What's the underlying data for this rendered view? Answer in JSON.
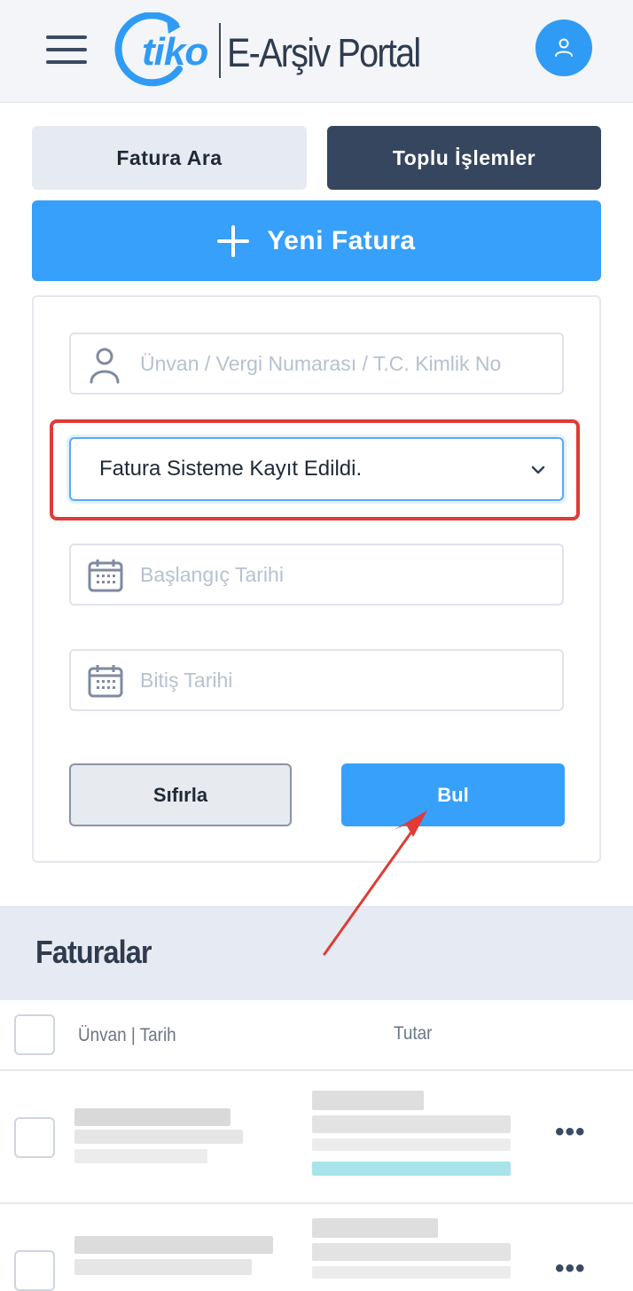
{
  "header": {
    "brand": "tiko",
    "product": "E-Arşiv Portal",
    "menu_icon": "hamburger-menu-icon",
    "profile_icon": "user-icon",
    "brand_color": "#2f9bf5"
  },
  "tabs": [
    {
      "label": "Fatura Ara",
      "active": true
    },
    {
      "label": "Toplu İşlemler",
      "active": false
    }
  ],
  "new_invoice": {
    "icon": "plus-icon",
    "label": "Yeni Fatura"
  },
  "filters": {
    "search": {
      "icon": "person-icon",
      "placeholder": "Ünvan / Vergi Numarası / T.C. Kimlik No",
      "value": ""
    },
    "status": {
      "selected": "Fatura Sisteme Kayıt Edildi.",
      "icon": "chevron-down-icon"
    },
    "start_date": {
      "icon": "calendar-icon",
      "placeholder": "Başlangıç Tarihi",
      "value": ""
    },
    "end_date": {
      "icon": "calendar-icon",
      "placeholder": "Bitiş Tarihi",
      "value": ""
    },
    "reset_label": "Sıfırla",
    "find_label": "Bul"
  },
  "invoices": {
    "title": "Faturalar",
    "columns": [
      "Ünvan | Tarih",
      "Tutar"
    ],
    "rows_visible": 2,
    "row_action_icon": "more-dots-icon"
  },
  "annotations": {
    "highlight_color": "#e03b36",
    "arrow_color": "#e03b36"
  }
}
